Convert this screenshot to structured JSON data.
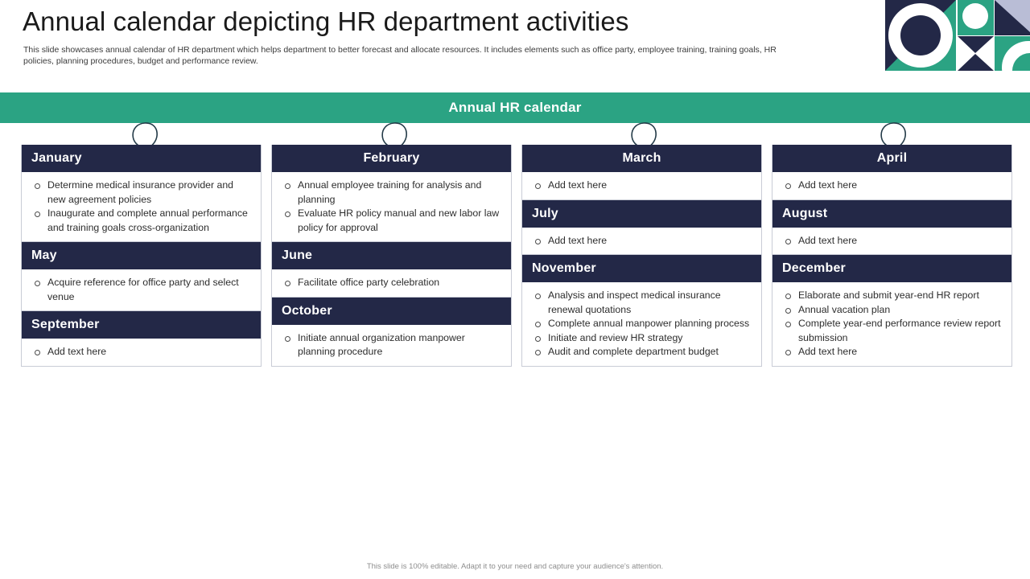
{
  "header": {
    "title": "Annual calendar depicting HR department activities",
    "subtitle": "This slide showcases annual calendar of HR department which helps department to better forecast and allocate resources. It includes elements such as office party, employee training,  training goals, HR policies, planning procedures, budget and performance review.",
    "logo_name": "geometric-mosaic-logo"
  },
  "banner": {
    "title": "Annual HR calendar",
    "color": "#2ba383"
  },
  "colors": {
    "accent_green": "#2ba383",
    "header_navy": "#232847",
    "card_border": "#c9ccd6",
    "body_text": "#2d2d2d"
  },
  "decorations": {
    "pin_count": 4,
    "pin_name": "hanging-loop-pin"
  },
  "calendar": {
    "rows": [
      {
        "header_align": "mixed",
        "months": [
          {
            "name": "January",
            "align": "left",
            "items": [
              "Determine medical insurance provider and new agreement policies",
              "Inaugurate and complete annual performance and training goals cross-organization"
            ]
          },
          {
            "name": "February",
            "align": "center",
            "items": [
              "Annual employee training for analysis and planning",
              "Evaluate HR policy manual and new labor law policy for approval"
            ]
          },
          {
            "name": "March",
            "align": "center",
            "items": [
              "Add text here"
            ]
          },
          {
            "name": "April",
            "align": "center",
            "items": [
              "Add text here"
            ]
          }
        ]
      },
      {
        "header_align": "left",
        "months": [
          {
            "name": "May",
            "align": "left",
            "items": [
              "Acquire reference for office party and select venue"
            ]
          },
          {
            "name": "June",
            "align": "left",
            "items": [
              "Facilitate office party celebration"
            ]
          },
          {
            "name": "July",
            "align": "left",
            "items": [
              "Add text here"
            ]
          },
          {
            "name": "August",
            "align": "left",
            "items": [
              "Add text here"
            ]
          }
        ]
      },
      {
        "header_align": "left",
        "months": [
          {
            "name": "September",
            "align": "left",
            "items": [
              "Add text here"
            ]
          },
          {
            "name": "October",
            "align": "left",
            "items": [
              "Initiate annual organization manpower planning procedure"
            ]
          },
          {
            "name": "November",
            "align": "left",
            "items": [
              "Analysis and inspect medical insurance renewal quotations",
              "Complete annual manpower planning process",
              "Initiate and review HR strategy",
              "Audit and complete department budget"
            ]
          },
          {
            "name": "December",
            "align": "left",
            "items": [
              "Elaborate and submit year-end HR report",
              "Annual vacation plan",
              "Complete year-end performance review report submission",
              "Add text here"
            ]
          }
        ]
      }
    ]
  },
  "footer": {
    "note": "This slide is 100% editable. Adapt it to your need and capture your audience's attention."
  }
}
